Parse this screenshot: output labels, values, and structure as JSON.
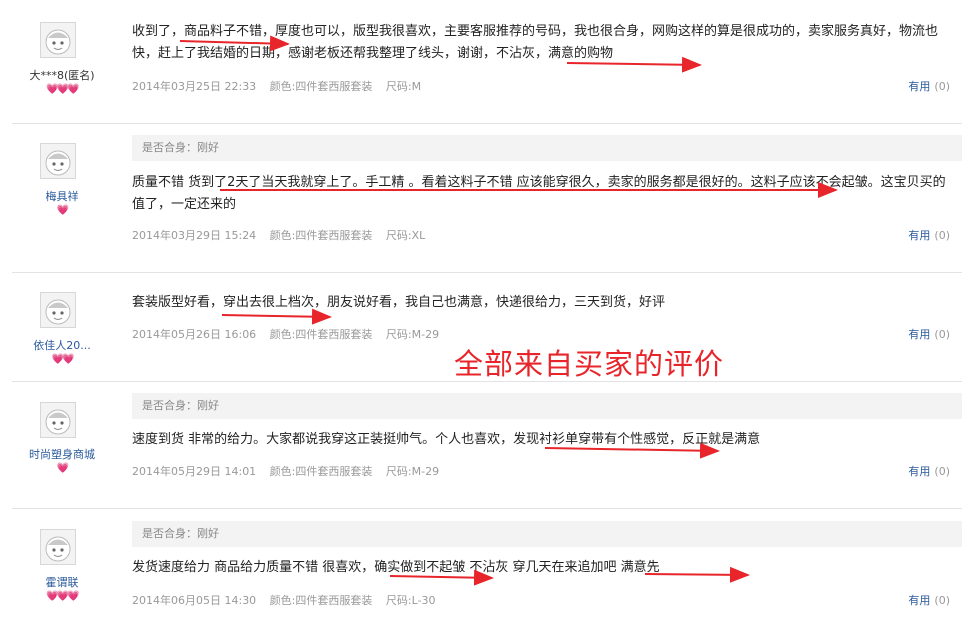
{
  "reviews": [
    {
      "user": "大***8(匿名)",
      "hearts": "💗💗💗",
      "fit": "",
      "content": "收到了，商品料子不错，厚度也可以，版型我很喜欢，主要客服推荐的号码，我也很合身，网购这样的算是很成功的，卖家服务真好，物流也快，赶上了我结婚的日期，感谢老板还帮我整理了线头，谢谢，不沾灰，满意的购物",
      "date": "2014年03月25日 22:33",
      "color": "颜色:四件套西服套装",
      "size": "尺码:M",
      "useful_label": "有用",
      "useful_count": "(0)"
    },
    {
      "user": "梅具祥",
      "hearts": "💗",
      "fit": "是否合身：刚好",
      "content": "质量不错 货到了2天了当天我就穿上了。手工精 。看着这料子不错 应该能穿很久，卖家的服务都是很好的。这料子应该不会起皱。这宝贝买的值了，一定还来的",
      "date": "2014年03月29日 15:24",
      "color": "颜色:四件套西服套装",
      "size": "尺码:XL",
      "useful_label": "有用",
      "useful_count": "(0)"
    },
    {
      "user": "依佳人20...",
      "hearts": "💗💗",
      "fit": "",
      "content": "套装版型好看，穿出去很上档次，朋友说好看，我自己也满意，快递很给力，三天到货，好评",
      "date": "2014年05月26日 16:06",
      "color": "颜色:四件套西服套装",
      "size": "尺码:M-29",
      "useful_label": "有用",
      "useful_count": "(0)"
    },
    {
      "user": "时尚塑身商城",
      "hearts": "💗",
      "fit": "是否合身：刚好",
      "content": "速度到货 非常的给力。大家都说我穿这正装挺帅气。个人也喜欢，发现衬衫单穿带有个性感觉，反正就是满意",
      "date": "2014年05月29日 14:01",
      "color": "颜色:四件套西服套装",
      "size": "尺码:M-29",
      "useful_label": "有用",
      "useful_count": "(0)"
    },
    {
      "user": "霍谓联",
      "hearts": "💗💗💗",
      "fit": "是否合身：刚好",
      "content": "发货速度给力 商品给力质量不错 很喜欢，确实做到不起皱 不沾灰 穿几天在来追加吧 满意先",
      "date": "2014年06月05日 14:30",
      "color": "颜色:四件套西服套装",
      "size": "尺码:L-30",
      "useful_label": "有用",
      "useful_count": "(0)"
    }
  ],
  "annotation": "全部来自买家的评价",
  "colors": {
    "link": "#2a5a9c",
    "annotation_red": "#e8252a",
    "meta_gray": "#999999"
  },
  "icons": {
    "avatar": "default-avatar-icon",
    "heart": "heart-icon",
    "arrow": "red-arrow-annotation"
  }
}
